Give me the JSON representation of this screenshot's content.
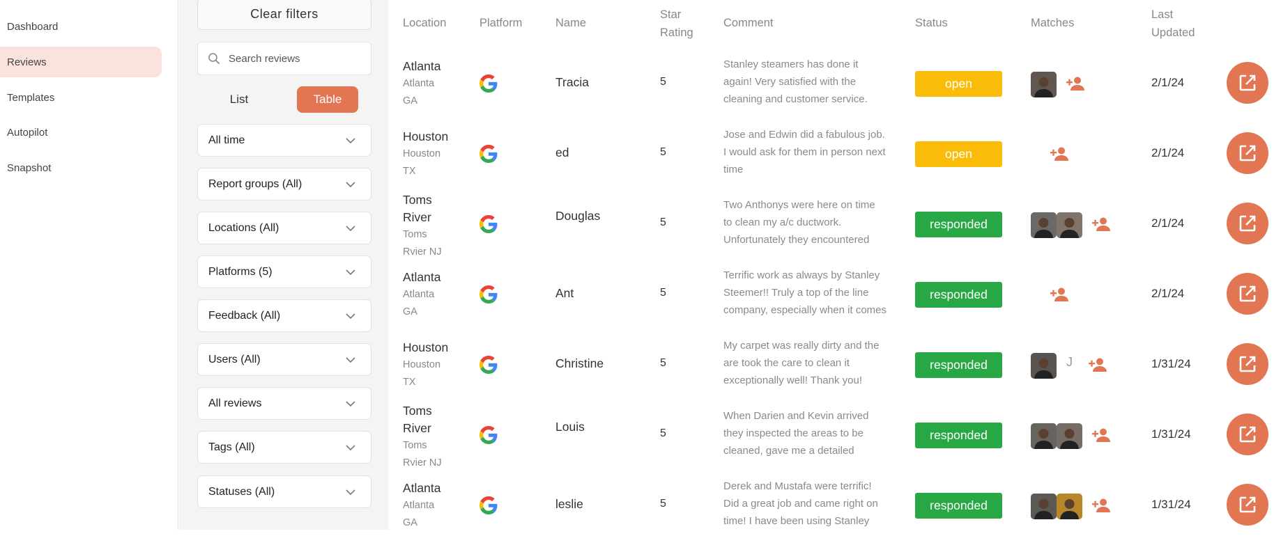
{
  "nav": {
    "items": [
      {
        "label": "Dashboard",
        "active": false
      },
      {
        "label": "Reviews",
        "active": true
      },
      {
        "label": "Templates",
        "active": false
      },
      {
        "label": "Autopilot",
        "active": false
      },
      {
        "label": "Snapshot",
        "active": false
      }
    ]
  },
  "filters": {
    "clear_label": "Clear filters",
    "search_placeholder": "Search reviews",
    "view_list_label": "List",
    "view_table_label": "Table",
    "view_selected": "Table",
    "dropdowns": [
      "All time",
      "Report groups (All)",
      "Locations (All)",
      "Platforms (5)",
      "Feedback (All)",
      "Users (All)",
      "All reviews",
      "Tags (All)",
      "Statuses (All)"
    ]
  },
  "table": {
    "headers": {
      "location": "Location",
      "platform": "Platform",
      "name": "Name",
      "star_rating_1": "Star",
      "star_rating_2": "Rating",
      "comment": "Comment",
      "status": "Status",
      "matches": "Matches",
      "last_updated_1": "Last",
      "last_updated_2": "Updated"
    },
    "rows": [
      {
        "city": "Atlanta",
        "sub1": "Atlanta",
        "sub2": "GA",
        "platform_icon": "google-icon",
        "name": "Tracia",
        "stars": "5",
        "comment": "Stanley steamers has done it again! Very satisfied with the cleaning and customer service. Rayvon was super friendly and helpful! God bless him",
        "status": "open",
        "matches": {
          "avatars": [
            "#2a1e16"
          ],
          "letter": ""
        },
        "updated": "2/1/24"
      },
      {
        "city": "Houston",
        "sub1": "Houston",
        "sub2": "TX",
        "platform_icon": "google-icon",
        "name": "ed",
        "stars": "5",
        "comment": "Jose and Edwin did a fabulous job. I would ask for them in person next time",
        "status": "open",
        "matches": {
          "avatars": [],
          "letter": ""
        },
        "updated": "2/1/24"
      },
      {
        "city": "Toms River",
        "sub1": "Toms",
        "sub2": "Rvier NJ",
        "platform_icon": "google-icon",
        "name": "Douglas",
        "stars": "5",
        "comment": "Two Anthonys were here on time to clean my a/c ductwork. Unfortunately they encountered mold in the air handler in the attic & were good enough",
        "status": "responded",
        "matches": {
          "avatars": [
            "#3a3a3a",
            "#5a4a3e"
          ],
          "letter": ""
        },
        "updated": "2/1/24"
      },
      {
        "city": "Atlanta",
        "sub1": "Atlanta",
        "sub2": "GA",
        "platform_icon": "google-icon",
        "name": "Ant",
        "stars": "5",
        "comment": "Terrific work as always by Stanley Steemer!! Truly a top of the line company, especially when it comes to carpet cleaning!! Staff are always",
        "status": "responded",
        "matches": {
          "avatars": [],
          "letter": ""
        },
        "updated": "2/1/24"
      },
      {
        "city": "Houston",
        "sub1": "Houston",
        "sub2": "TX",
        "platform_icon": "google-icon",
        "name": "Christine",
        "stars": "5",
        "comment": "My carpet was really dirty and the are took the care to clean it exceptionally well! Thank you!",
        "status": "responded",
        "matches": {
          "avatars": [
            "#1f1a17"
          ],
          "letter": "J"
        },
        "updated": "1/31/24"
      },
      {
        "city": "Toms River",
        "sub1": "Toms",
        "sub2": "Rvier NJ",
        "platform_icon": "google-icon",
        "name": "Louis",
        "stars": "5",
        "comment": "When Darien and Kevin arrived they inspected the areas to be cleaned, gave me a detailed description of what they were going to do, time estimate and",
        "status": "responded",
        "matches": {
          "avatars": [
            "#33302c",
            "#4a4038"
          ],
          "letter": ""
        },
        "updated": "1/31/24"
      },
      {
        "city": "Atlanta",
        "sub1": "Atlanta",
        "sub2": "GA",
        "platform_icon": "google-icon",
        "name": "leslie",
        "stars": "5",
        "comment": "Derek and Mustafa were terrific! Did a great job and came right on time! I have been using Stanley Steemer for close",
        "status": "responded",
        "matches": {
          "avatars": [
            "#23201d",
            "#b8862b"
          ],
          "letter": ""
        },
        "updated": "1/31/24"
      }
    ]
  },
  "colors": {
    "accent": "#e27552",
    "open": "#fbbc09",
    "responded": "#27a844",
    "nav_active_bg": "#fae3dc"
  }
}
